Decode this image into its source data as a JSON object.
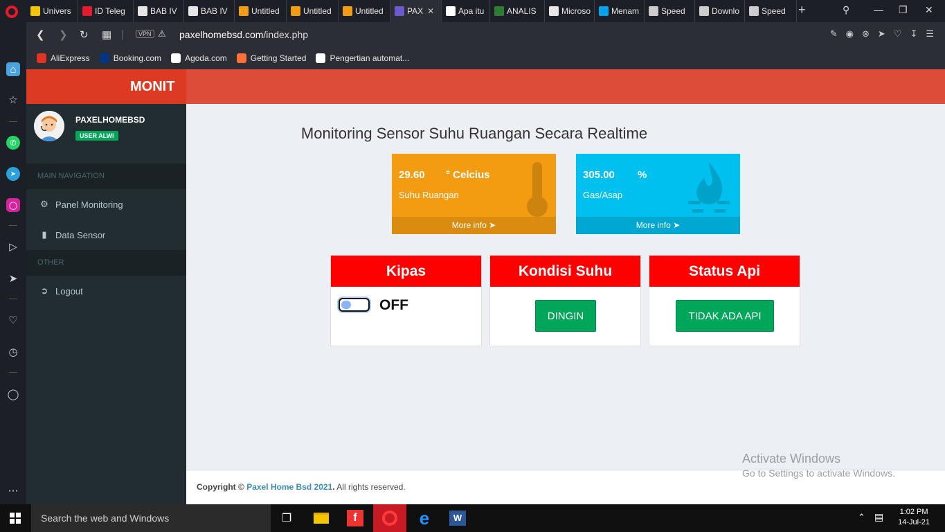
{
  "browser": {
    "tabs": [
      {
        "label": "Univers",
        "color": "#f5c400"
      },
      {
        "label": "ID Teleg",
        "color": "#e8192c"
      },
      {
        "label": "BAB IV",
        "color": "#e6e6e6"
      },
      {
        "label": "BAB IV",
        "color": "#e6e6e6"
      },
      {
        "label": "Untitled",
        "color": "#f39c12"
      },
      {
        "label": "Untitled",
        "color": "#f39c12"
      },
      {
        "label": "Untitled",
        "color": "#f39c12"
      },
      {
        "label": "PAX",
        "color": "#6a5acd",
        "active": true
      },
      {
        "label": "Apa itu",
        "color": "#ffffff"
      },
      {
        "label": "ANALIS",
        "color": "#2e7d32"
      },
      {
        "label": "Microso",
        "color": "#e6e6e6"
      },
      {
        "label": "Menam",
        "color": "#00a4ef"
      },
      {
        "label": "Speed",
        "color": "#cccccc"
      },
      {
        "label": "Downlo",
        "color": "#cccccc"
      },
      {
        "label": "Speed",
        "color": "#cccccc"
      }
    ],
    "vpn_label": "VPN",
    "url_domain": "paxelhomebsd.com",
    "url_path": "/index.php",
    "bookmarks": [
      {
        "label": "AliExpress",
        "color": "#e43225"
      },
      {
        "label": "Booking.com",
        "color": "#003580"
      },
      {
        "label": "Agoda.com",
        "color": "#ffffff"
      },
      {
        "label": "Getting Started",
        "color": "#ff7139"
      },
      {
        "label": "Pengertian automat...",
        "color": "#ffffff"
      }
    ]
  },
  "app": {
    "brand": "MONIT",
    "user": {
      "name": "PAXELHOMEBSD",
      "badge": "USER ALWI"
    },
    "nav_main_header": "MAIN NAVIGATION",
    "nav_items": [
      {
        "label": "Panel Monitoring",
        "icon": "dashboard-icon"
      },
      {
        "label": "Data Sensor",
        "icon": "file-icon"
      }
    ],
    "nav_other_header": "OTHER",
    "logout": {
      "label": "Logout",
      "icon": "sign-out-icon"
    },
    "page_title": "Monitoring Sensor Suhu Ruangan Secara Realtime",
    "temp_box": {
      "value": "29.60",
      "unit": "° Celcius",
      "label": "Suhu Ruangan",
      "more": "More info",
      "icon": "thermometer-icon",
      "color": "#f39c12"
    },
    "gas_box": {
      "value": "305.00",
      "unit": "%",
      "label": "Gas/Asap",
      "more": "More info",
      "icon": "fire-icon",
      "color": "#00c0ef"
    },
    "kipas": {
      "title": "Kipas",
      "state": "OFF"
    },
    "kondisi": {
      "title": "Kondisi Suhu",
      "button": "DINGIN"
    },
    "status_api": {
      "title": "Status Api",
      "button": "TIDAK ADA API"
    },
    "footer": {
      "prefix": "Copyright ©",
      "link": "Paxel Home Bsd 2021",
      "suffix": "All rights reserved."
    }
  },
  "watermark": {
    "line1": "Activate Windows",
    "line2": "Go to Settings to activate Windows."
  },
  "taskbar": {
    "search_placeholder": "Search the web and Windows",
    "time": "1:02 PM",
    "date": "14-Jul-21"
  }
}
